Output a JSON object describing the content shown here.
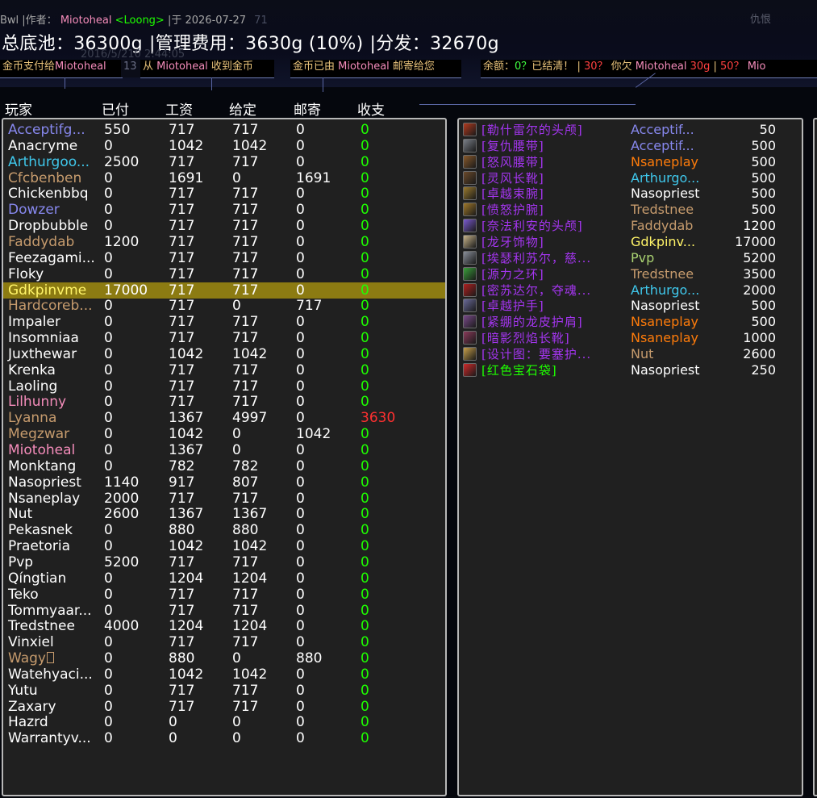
{
  "colors": {
    "warrior": "#c69b6d",
    "mage": "#3fc7eb",
    "priest": "#ffffff",
    "warlock": "#8788ee",
    "rogue": "#fff468",
    "druid": "#ff7c0a",
    "hunter": "#aad372",
    "paladin": "#f48cba",
    "epic": "#a335ee",
    "uncommon": "#1eff00",
    "deficit": "#ff3030"
  },
  "header": {
    "subtitle_prefix": "Bwl |作者：",
    "author": "Miotoheal",
    "author_tag": "<Loong>",
    "subtitle_date": "|于 2026-07-27",
    "subtitle_ghost": "71",
    "corner": "仇恨",
    "summary_pool": "总底池：36300g",
    "summary_fee": "|管理费用：3630g (10%)",
    "summary_split": "|分发：32670g",
    "ghost_line": "2016/5/210    2:44:05"
  },
  "messages": {
    "m1_prefix": "金币支付给",
    "m1_name": "Miotoheal",
    "m1_suffix": "13",
    "m2_prefix": "从 ",
    "m2_name": "Miotoheal",
    "m2_suffix": " 收到金币",
    "m3_prefix": "金币已由 ",
    "m3_name": "Miotoheal",
    "m3_suffix": " 邮寄给您",
    "m4_a": "余额：",
    "m4_b": "0？",
    "m4_c": "已结清！",
    "m4_d": " | ",
    "m4_e": "30？",
    "m4_f": " 你欠 ",
    "m4_g": "Miotoheal",
    "m4_h": " 30g",
    "m4_i": " | ",
    "m4_j": "50？",
    "m4_k": " Mio"
  },
  "columns": {
    "player": "玩家",
    "paid": "已付",
    "wage": "工资",
    "given": "给定",
    "mail": "邮寄",
    "balance": "收支"
  },
  "players": [
    {
      "name": "Acceptifg...",
      "cls": "warlock",
      "paid": "550",
      "wage": "717",
      "given": "717",
      "mail": "0",
      "bal": "0"
    },
    {
      "name": "Anacryme",
      "cls": "priest",
      "paid": "0",
      "wage": "1042",
      "given": "1042",
      "mail": "0",
      "bal": "0"
    },
    {
      "name": "Arthurgoo...",
      "cls": "mage",
      "paid": "2500",
      "wage": "717",
      "given": "717",
      "mail": "0",
      "bal": "0"
    },
    {
      "name": "Cfcbenben",
      "cls": "warrior",
      "paid": "0",
      "wage": "1691",
      "given": "0",
      "mail": "1691",
      "bal": "0"
    },
    {
      "name": "Chickenbbq",
      "cls": "priest",
      "paid": "0",
      "wage": "717",
      "given": "717",
      "mail": "0",
      "bal": "0"
    },
    {
      "name": "Dowzer",
      "cls": "warlock",
      "paid": "0",
      "wage": "717",
      "given": "717",
      "mail": "0",
      "bal": "0"
    },
    {
      "name": "Dropbubble",
      "cls": "priest",
      "paid": "0",
      "wage": "717",
      "given": "717",
      "mail": "0",
      "bal": "0"
    },
    {
      "name": "Faddydab",
      "cls": "warrior",
      "paid": "1200",
      "wage": "717",
      "given": "717",
      "mail": "0",
      "bal": "0"
    },
    {
      "name": "Feezagami...",
      "cls": "priest",
      "paid": "0",
      "wage": "717",
      "given": "717",
      "mail": "0",
      "bal": "0"
    },
    {
      "name": "Floky",
      "cls": "priest",
      "paid": "0",
      "wage": "717",
      "given": "717",
      "mail": "0",
      "bal": "0"
    },
    {
      "name": "Gdkpinvme",
      "cls": "rogue",
      "paid": "17000",
      "wage": "717",
      "given": "717",
      "mail": "0",
      "bal": "0",
      "highlight": true
    },
    {
      "name": "Hardcoreb...",
      "cls": "warrior",
      "paid": "0",
      "wage": "717",
      "given": "0",
      "mail": "717",
      "bal": "0"
    },
    {
      "name": "Impaler",
      "cls": "priest",
      "paid": "0",
      "wage": "717",
      "given": "717",
      "mail": "0",
      "bal": "0"
    },
    {
      "name": "Insomniaa",
      "cls": "priest",
      "paid": "0",
      "wage": "717",
      "given": "717",
      "mail": "0",
      "bal": "0"
    },
    {
      "name": "Juxthewar",
      "cls": "priest",
      "paid": "0",
      "wage": "1042",
      "given": "1042",
      "mail": "0",
      "bal": "0"
    },
    {
      "name": "Krenka",
      "cls": "priest",
      "paid": "0",
      "wage": "717",
      "given": "717",
      "mail": "0",
      "bal": "0"
    },
    {
      "name": "Laoling",
      "cls": "priest",
      "paid": "0",
      "wage": "717",
      "given": "717",
      "mail": "0",
      "bal": "0"
    },
    {
      "name": "Lilhunny",
      "cls": "paladin",
      "paid": "0",
      "wage": "717",
      "given": "717",
      "mail": "0",
      "bal": "0"
    },
    {
      "name": "Lyanna",
      "cls": "warrior",
      "paid": "0",
      "wage": "1367",
      "given": "4997",
      "mail": "0",
      "bal": "3630",
      "deficit": true
    },
    {
      "name": "Megzwar",
      "cls": "warrior",
      "paid": "0",
      "wage": "1042",
      "given": "0",
      "mail": "1042",
      "bal": "0"
    },
    {
      "name": "Miotoheal",
      "cls": "paladin",
      "paid": "0",
      "wage": "1367",
      "given": "0",
      "mail": "0",
      "bal": "0"
    },
    {
      "name": "Monktang",
      "cls": "priest",
      "paid": "0",
      "wage": "782",
      "given": "782",
      "mail": "0",
      "bal": "0"
    },
    {
      "name": "Nasopriest",
      "cls": "priest",
      "paid": "1140",
      "wage": "917",
      "given": "807",
      "mail": "0",
      "bal": "0"
    },
    {
      "name": "Nsaneplay",
      "cls": "priest",
      "paid": "2000",
      "wage": "717",
      "given": "717",
      "mail": "0",
      "bal": "0"
    },
    {
      "name": "Nut",
      "cls": "priest",
      "paid": "2600",
      "wage": "1367",
      "given": "1367",
      "mail": "0",
      "bal": "0"
    },
    {
      "name": "Pekasnek",
      "cls": "priest",
      "paid": "0",
      "wage": "880",
      "given": "880",
      "mail": "0",
      "bal": "0"
    },
    {
      "name": "Praetoria",
      "cls": "priest",
      "paid": "0",
      "wage": "1042",
      "given": "1042",
      "mail": "0",
      "bal": "0"
    },
    {
      "name": "Pvp",
      "cls": "priest",
      "paid": "5200",
      "wage": "717",
      "given": "717",
      "mail": "0",
      "bal": "0"
    },
    {
      "name": "Qíngtian",
      "cls": "priest",
      "paid": "0",
      "wage": "1204",
      "given": "1204",
      "mail": "0",
      "bal": "0"
    },
    {
      "name": "Teko",
      "cls": "priest",
      "paid": "0",
      "wage": "717",
      "given": "717",
      "mail": "0",
      "bal": "0"
    },
    {
      "name": "Tommyaar...",
      "cls": "priest",
      "paid": "0",
      "wage": "717",
      "given": "717",
      "mail": "0",
      "bal": "0"
    },
    {
      "name": "Tredstnee",
      "cls": "priest",
      "paid": "4000",
      "wage": "1204",
      "given": "1204",
      "mail": "0",
      "bal": "0"
    },
    {
      "name": "Vinxiel",
      "cls": "priest",
      "paid": "0",
      "wage": "717",
      "given": "717",
      "mail": "0",
      "bal": "0"
    },
    {
      "name": "Wagy",
      "cls": "warrior",
      "paid": "0",
      "wage": "880",
      "given": "0",
      "mail": "880",
      "bal": "0",
      "box": true
    },
    {
      "name": "Watehyaci...",
      "cls": "priest",
      "paid": "0",
      "wage": "1042",
      "given": "1042",
      "mail": "0",
      "bal": "0"
    },
    {
      "name": "Yutu",
      "cls": "priest",
      "paid": "0",
      "wage": "717",
      "given": "717",
      "mail": "0",
      "bal": "0"
    },
    {
      "name": "Zaxary",
      "cls": "priest",
      "paid": "0",
      "wage": "717",
      "given": "717",
      "mail": "0",
      "bal": "0"
    },
    {
      "name": "Hazrd",
      "cls": "priest",
      "paid": "0",
      "wage": "0",
      "given": "0",
      "mail": "0",
      "bal": "0"
    },
    {
      "name": "Warrantyv...",
      "cls": "priest",
      "paid": "0",
      "wage": "0",
      "given": "0",
      "mail": "0",
      "bal": "0"
    }
  ],
  "loot": [
    {
      "item": "[勒什雷尔的头颅]",
      "quality": "epic",
      "icon": "nefarian-head-icon",
      "icon_color": "#b23a1e",
      "winner": "Acceptif...",
      "wcls": "warlock",
      "price": "50"
    },
    {
      "item": "[复仇腰带]",
      "quality": "epic",
      "icon": "belt-icon",
      "icon_color": "#7a7f88",
      "winner": "Acceptif...",
      "wcls": "warlock",
      "price": "500"
    },
    {
      "item": "[怒风腰带]",
      "quality": "epic",
      "icon": "belt-icon",
      "icon_color": "#8a5a2b",
      "winner": "Nsaneplay",
      "wcls": "druid",
      "price": "500"
    },
    {
      "item": "[灵风长靴]",
      "quality": "epic",
      "icon": "boots-icon",
      "icon_color": "#6b4a2a",
      "winner": "Arthurgo...",
      "wcls": "mage",
      "price": "500"
    },
    {
      "item": "[卓越束腕]",
      "quality": "epic",
      "icon": "bracer-icon",
      "icon_color": "#9a7a2e",
      "winner": "Nasopriest",
      "wcls": "priest",
      "price": "500"
    },
    {
      "item": "[愤怒护腕]",
      "quality": "epic",
      "icon": "bracer-icon",
      "icon_color": "#a0782a",
      "winner": "Tredstnee",
      "wcls": "warrior",
      "price": "500"
    },
    {
      "item": "[奈法利安的头颅]",
      "quality": "epic",
      "icon": "head-icon",
      "icon_color": "#7a5ad0",
      "winner": "Faddydab",
      "wcls": "warrior",
      "price": "1200"
    },
    {
      "item": "[龙牙饰物]",
      "quality": "epic",
      "icon": "fang-icon",
      "icon_color": "#c8b48a",
      "winner": "Gdkpinv...",
      "wcls": "rogue",
      "price": "17000"
    },
    {
      "item": "[埃瑟利苏尔，慈...",
      "quality": "epic",
      "icon": "sword-icon",
      "icon_color": "#8a8f9a",
      "winner": "Pvp",
      "wcls": "hunter",
      "price": "5200"
    },
    {
      "item": "[源力之环]",
      "quality": "epic",
      "icon": "ring-icon",
      "icon_color": "#3aa03a",
      "winner": "Tredstnee",
      "wcls": "warrior",
      "price": "3500"
    },
    {
      "item": "[密苏达尔，夺魂...",
      "quality": "epic",
      "icon": "staff-icon",
      "icon_color": "#b02020",
      "winner": "Arthurgo...",
      "wcls": "mage",
      "price": "2000"
    },
    {
      "item": "[卓越护手]",
      "quality": "epic",
      "icon": "gloves-icon",
      "icon_color": "#6a6a9a",
      "winner": "Nasopriest",
      "wcls": "priest",
      "price": "500"
    },
    {
      "item": "[紧绷的龙皮护肩]",
      "quality": "epic",
      "icon": "shoulder-icon",
      "icon_color": "#7a4a8a",
      "winner": "Nsaneplay",
      "wcls": "druid",
      "price": "500"
    },
    {
      "item": "[暗影烈焰长靴]",
      "quality": "epic",
      "icon": "boots-icon",
      "icon_color": "#8a3a5a",
      "winner": "Nsaneplay",
      "wcls": "druid",
      "price": "1000"
    },
    {
      "item": "[设计图：要塞护...",
      "quality": "epic",
      "icon": "scroll-icon",
      "icon_color": "#c8a04a",
      "winner": "Nut",
      "wcls": "warrior",
      "price": "2600"
    },
    {
      "item": "[红色宝石袋]",
      "quality": "uncommon",
      "icon": "gem-bag-icon",
      "icon_color": "#d02a2a",
      "winner": "Nasopriest",
      "wcls": "priest",
      "price": "250"
    }
  ]
}
